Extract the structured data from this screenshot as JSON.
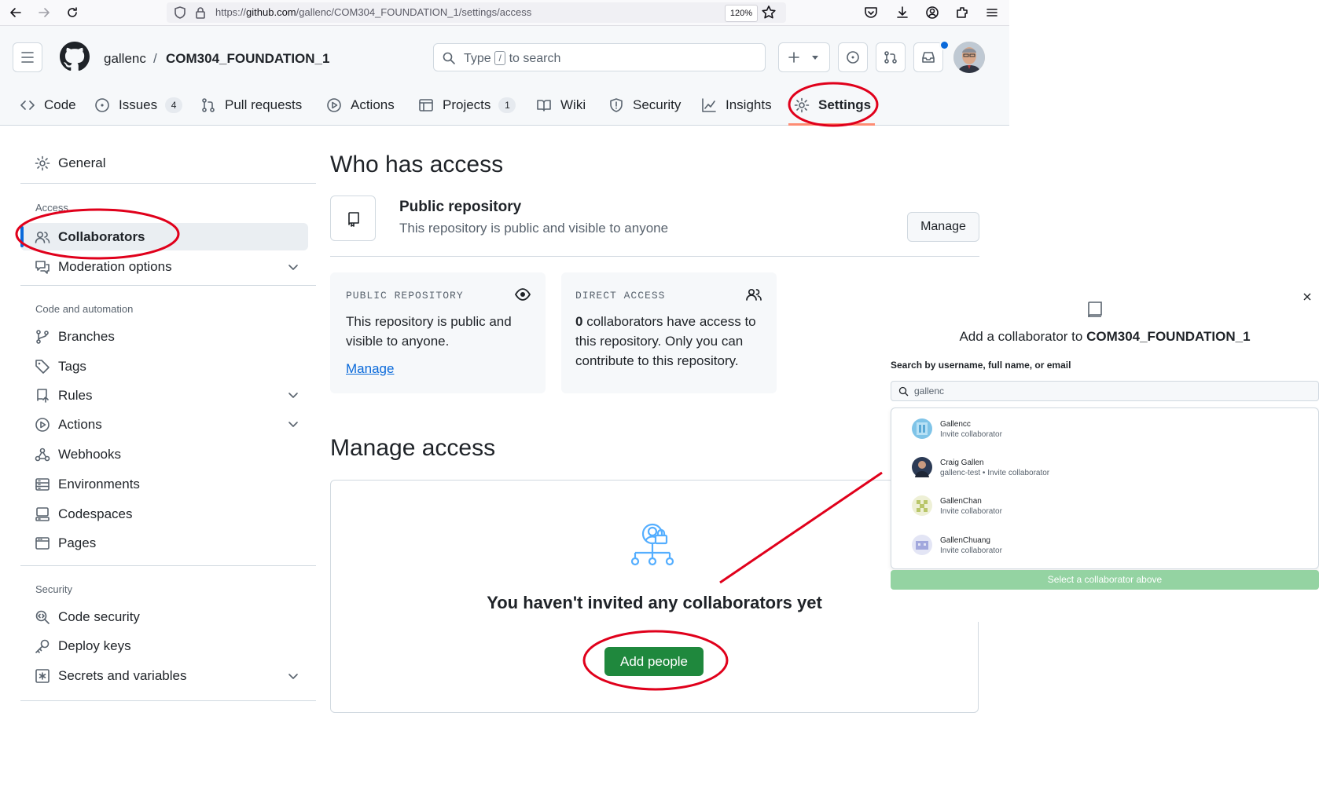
{
  "browser": {
    "url_prefix": "https://",
    "url_domain": "github.com",
    "url_path": "/gallenc/COM304_FOUNDATION_1/settings/access",
    "zoom": "120%"
  },
  "header": {
    "owner": "gallenc",
    "separator": "/",
    "repo": "COM304_FOUNDATION_1",
    "search_before": "Type",
    "search_key": "/",
    "search_after": "to search"
  },
  "tabs": [
    {
      "label": "Code"
    },
    {
      "label": "Issues",
      "count": "4"
    },
    {
      "label": "Pull requests"
    },
    {
      "label": "Actions"
    },
    {
      "label": "Projects",
      "count": "1"
    },
    {
      "label": "Wiki"
    },
    {
      "label": "Security"
    },
    {
      "label": "Insights"
    },
    {
      "label": "Settings"
    }
  ],
  "sidebar": {
    "general": "General",
    "access_heading": "Access",
    "collaborators": "Collaborators",
    "moderation": "Moderation options",
    "code_automation_heading": "Code and automation",
    "branches": "Branches",
    "tags": "Tags",
    "rules": "Rules",
    "actions": "Actions",
    "webhooks": "Webhooks",
    "environments": "Environments",
    "codespaces": "Codespaces",
    "pages": "Pages",
    "security_heading": "Security",
    "code_security": "Code security",
    "deploy_keys": "Deploy keys",
    "secrets": "Secrets and variables"
  },
  "main": {
    "who_has_access": "Who has access",
    "repo_visibility_title": "Public repository",
    "repo_visibility_desc": "This repository is public and visible to anyone",
    "manage_button": "Manage",
    "card_public_label": "PUBLIC REPOSITORY",
    "card_public_body": "This repository is public and visible to anyone.",
    "card_public_link": "Manage",
    "card_direct_label": "DIRECT ACCESS",
    "card_direct_count": "0",
    "card_direct_body": " collaborators have access to this repository. Only you can contribute to this repository.",
    "manage_access": "Manage access",
    "empty_title": "You haven't invited any collaborators yet",
    "add_people": "Add people"
  },
  "modal": {
    "title_prefix": "Add a collaborator to ",
    "title_repo": "COM304_FOUNDATION_1",
    "search_label": "Search by username, full name, or email",
    "search_value": "gallenc",
    "suggestions": [
      {
        "name": "Gallencc",
        "sub": "Invite collaborator"
      },
      {
        "name": "Craig Gallen",
        "sub": "gallenc-test • Invite collaborator"
      },
      {
        "name": "GallenChan",
        "sub": "Invite collaborator"
      },
      {
        "name": "GallenChuang",
        "sub": "Invite collaborator"
      }
    ],
    "select_button": "Select a collaborator above"
  },
  "colors": {
    "primary_green": "#1f883d",
    "disabled_green": "#94d3a2",
    "annotation_red": "#e0001b",
    "link_blue": "#0969da",
    "active_tab_underline": "#fd8c73"
  }
}
